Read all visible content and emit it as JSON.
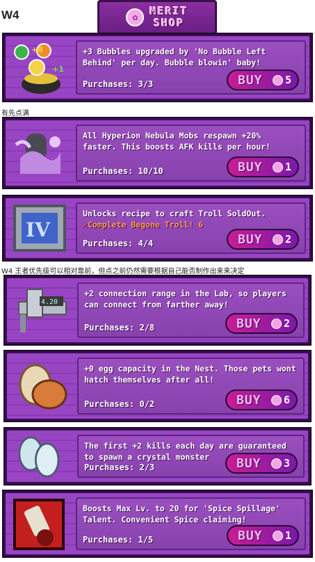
{
  "page": {
    "heading": "W4",
    "note_1": "有先点满",
    "note_2": "W4 王者优先级可以相对靠前，但点之前仍然需要根据自己能否制作出来来决定"
  },
  "banner": {
    "line1": "MERIT",
    "line2": "SHOP"
  },
  "buy_label": "BUY",
  "items": [
    {
      "icon": "bubble-cauldron-icon",
      "desc": "+3 Bubbles upgraded by 'No Bubble Left Behind' per day. Bubble blowin' baby!",
      "requirement": "",
      "purchases": "Purchases: 3/3",
      "cost": "5"
    },
    {
      "icon": "hyperion-nebula-mob-icon",
      "desc": "All Hyperion Nebula Mobs respawn +20% faster. This boosts AFK kills per hour!",
      "requirement": "",
      "purchases": "Purchases: 10/10",
      "cost": "1"
    },
    {
      "icon": "troll-iv-tablet-icon",
      "desc": "Unlocks recipe to craft Troll SoldOut.",
      "requirement": "Complete Begone Troll! 6",
      "purchases": "Purchases: 4/4",
      "cost": "2"
    },
    {
      "icon": "caliper-gauge-icon",
      "desc": "+2 connection range in the Lab, so players can connect from farther away!",
      "requirement": "",
      "purchases": "Purchases: 2/8",
      "cost": "2"
    },
    {
      "icon": "egg-icon",
      "desc": "+0 egg capacity in the Nest. Those pets wont hatch themselves after all!",
      "requirement": "",
      "purchases": "Purchases: 0/2",
      "cost": "6"
    },
    {
      "icon": "crystal-monster-icon",
      "desc": "The first +2 kills each day are guaranteed to spawn a crystal monster",
      "requirement": "",
      "purchases": "Purchases: 2/3",
      "cost": "3"
    },
    {
      "icon": "spice-spillage-talent-icon",
      "desc": "Boosts Max Lv. to 20 for 'Spice Spillage' Talent. Convenient Spice claiming!",
      "requirement": "",
      "purchases": "Purchases: 1/5",
      "cost": "1"
    }
  ]
}
